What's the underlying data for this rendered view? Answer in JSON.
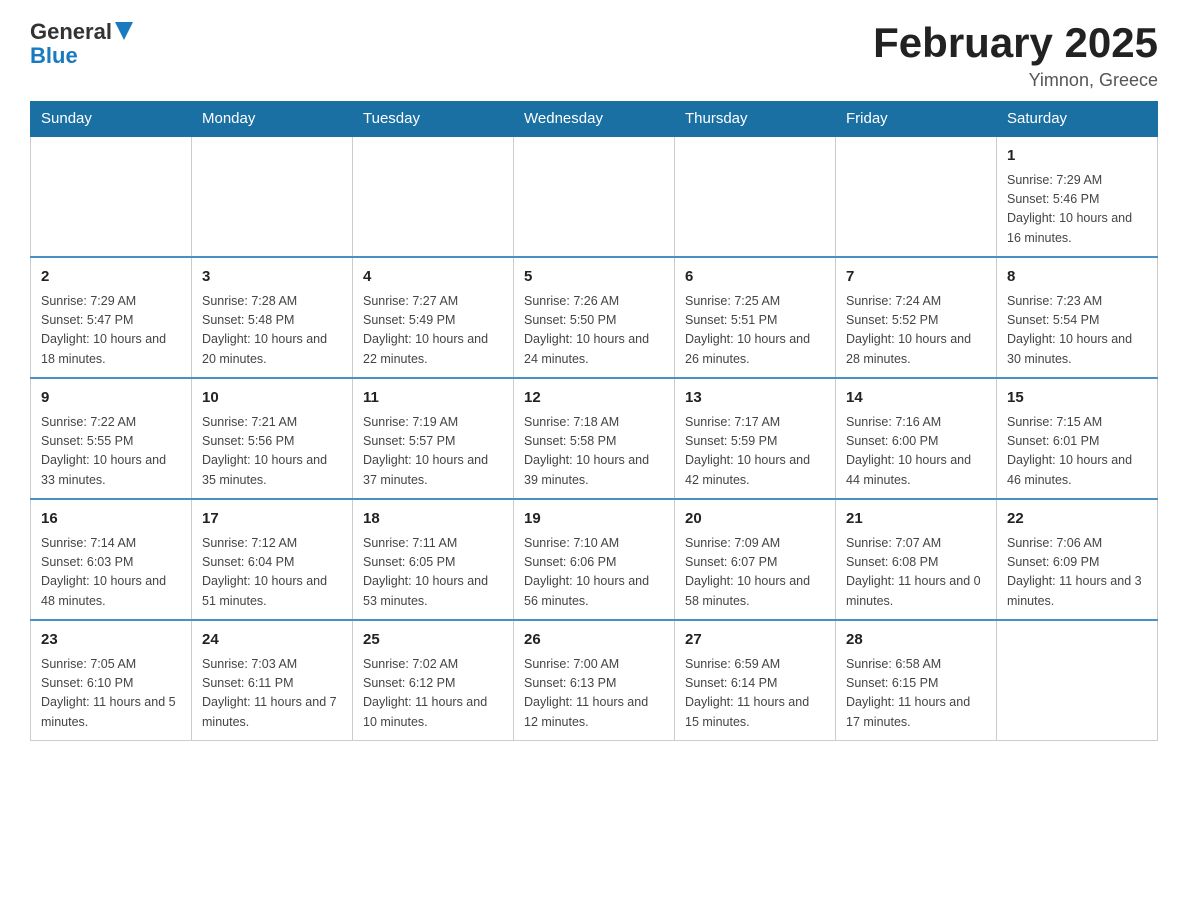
{
  "header": {
    "logo": {
      "general": "General",
      "blue": "Blue",
      "alt": "GeneralBlue logo"
    },
    "title": "February 2025",
    "subtitle": "Yimnon, Greece"
  },
  "days_of_week": [
    "Sunday",
    "Monday",
    "Tuesday",
    "Wednesday",
    "Thursday",
    "Friday",
    "Saturday"
  ],
  "weeks": [
    {
      "days": [
        {
          "number": "",
          "info": "",
          "empty": true
        },
        {
          "number": "",
          "info": "",
          "empty": true
        },
        {
          "number": "",
          "info": "",
          "empty": true
        },
        {
          "number": "",
          "info": "",
          "empty": true
        },
        {
          "number": "",
          "info": "",
          "empty": true
        },
        {
          "number": "",
          "info": "",
          "empty": true
        },
        {
          "number": "1",
          "info": "Sunrise: 7:29 AM\nSunset: 5:46 PM\nDaylight: 10 hours and 16 minutes."
        }
      ]
    },
    {
      "days": [
        {
          "number": "2",
          "info": "Sunrise: 7:29 AM\nSunset: 5:47 PM\nDaylight: 10 hours and 18 minutes."
        },
        {
          "number": "3",
          "info": "Sunrise: 7:28 AM\nSunset: 5:48 PM\nDaylight: 10 hours and 20 minutes."
        },
        {
          "number": "4",
          "info": "Sunrise: 7:27 AM\nSunset: 5:49 PM\nDaylight: 10 hours and 22 minutes."
        },
        {
          "number": "5",
          "info": "Sunrise: 7:26 AM\nSunset: 5:50 PM\nDaylight: 10 hours and 24 minutes."
        },
        {
          "number": "6",
          "info": "Sunrise: 7:25 AM\nSunset: 5:51 PM\nDaylight: 10 hours and 26 minutes."
        },
        {
          "number": "7",
          "info": "Sunrise: 7:24 AM\nSunset: 5:52 PM\nDaylight: 10 hours and 28 minutes."
        },
        {
          "number": "8",
          "info": "Sunrise: 7:23 AM\nSunset: 5:54 PM\nDaylight: 10 hours and 30 minutes."
        }
      ]
    },
    {
      "days": [
        {
          "number": "9",
          "info": "Sunrise: 7:22 AM\nSunset: 5:55 PM\nDaylight: 10 hours and 33 minutes."
        },
        {
          "number": "10",
          "info": "Sunrise: 7:21 AM\nSunset: 5:56 PM\nDaylight: 10 hours and 35 minutes."
        },
        {
          "number": "11",
          "info": "Sunrise: 7:19 AM\nSunset: 5:57 PM\nDaylight: 10 hours and 37 minutes."
        },
        {
          "number": "12",
          "info": "Sunrise: 7:18 AM\nSunset: 5:58 PM\nDaylight: 10 hours and 39 minutes."
        },
        {
          "number": "13",
          "info": "Sunrise: 7:17 AM\nSunset: 5:59 PM\nDaylight: 10 hours and 42 minutes."
        },
        {
          "number": "14",
          "info": "Sunrise: 7:16 AM\nSunset: 6:00 PM\nDaylight: 10 hours and 44 minutes."
        },
        {
          "number": "15",
          "info": "Sunrise: 7:15 AM\nSunset: 6:01 PM\nDaylight: 10 hours and 46 minutes."
        }
      ]
    },
    {
      "days": [
        {
          "number": "16",
          "info": "Sunrise: 7:14 AM\nSunset: 6:03 PM\nDaylight: 10 hours and 48 minutes."
        },
        {
          "number": "17",
          "info": "Sunrise: 7:12 AM\nSunset: 6:04 PM\nDaylight: 10 hours and 51 minutes."
        },
        {
          "number": "18",
          "info": "Sunrise: 7:11 AM\nSunset: 6:05 PM\nDaylight: 10 hours and 53 minutes."
        },
        {
          "number": "19",
          "info": "Sunrise: 7:10 AM\nSunset: 6:06 PM\nDaylight: 10 hours and 56 minutes."
        },
        {
          "number": "20",
          "info": "Sunrise: 7:09 AM\nSunset: 6:07 PM\nDaylight: 10 hours and 58 minutes."
        },
        {
          "number": "21",
          "info": "Sunrise: 7:07 AM\nSunset: 6:08 PM\nDaylight: 11 hours and 0 minutes."
        },
        {
          "number": "22",
          "info": "Sunrise: 7:06 AM\nSunset: 6:09 PM\nDaylight: 11 hours and 3 minutes."
        }
      ]
    },
    {
      "days": [
        {
          "number": "23",
          "info": "Sunrise: 7:05 AM\nSunset: 6:10 PM\nDaylight: 11 hours and 5 minutes."
        },
        {
          "number": "24",
          "info": "Sunrise: 7:03 AM\nSunset: 6:11 PM\nDaylight: 11 hours and 7 minutes."
        },
        {
          "number": "25",
          "info": "Sunrise: 7:02 AM\nSunset: 6:12 PM\nDaylight: 11 hours and 10 minutes."
        },
        {
          "number": "26",
          "info": "Sunrise: 7:00 AM\nSunset: 6:13 PM\nDaylight: 11 hours and 12 minutes."
        },
        {
          "number": "27",
          "info": "Sunrise: 6:59 AM\nSunset: 6:14 PM\nDaylight: 11 hours and 15 minutes."
        },
        {
          "number": "28",
          "info": "Sunrise: 6:58 AM\nSunset: 6:15 PM\nDaylight: 11 hours and 17 minutes."
        },
        {
          "number": "",
          "info": "",
          "empty": true
        }
      ]
    }
  ]
}
